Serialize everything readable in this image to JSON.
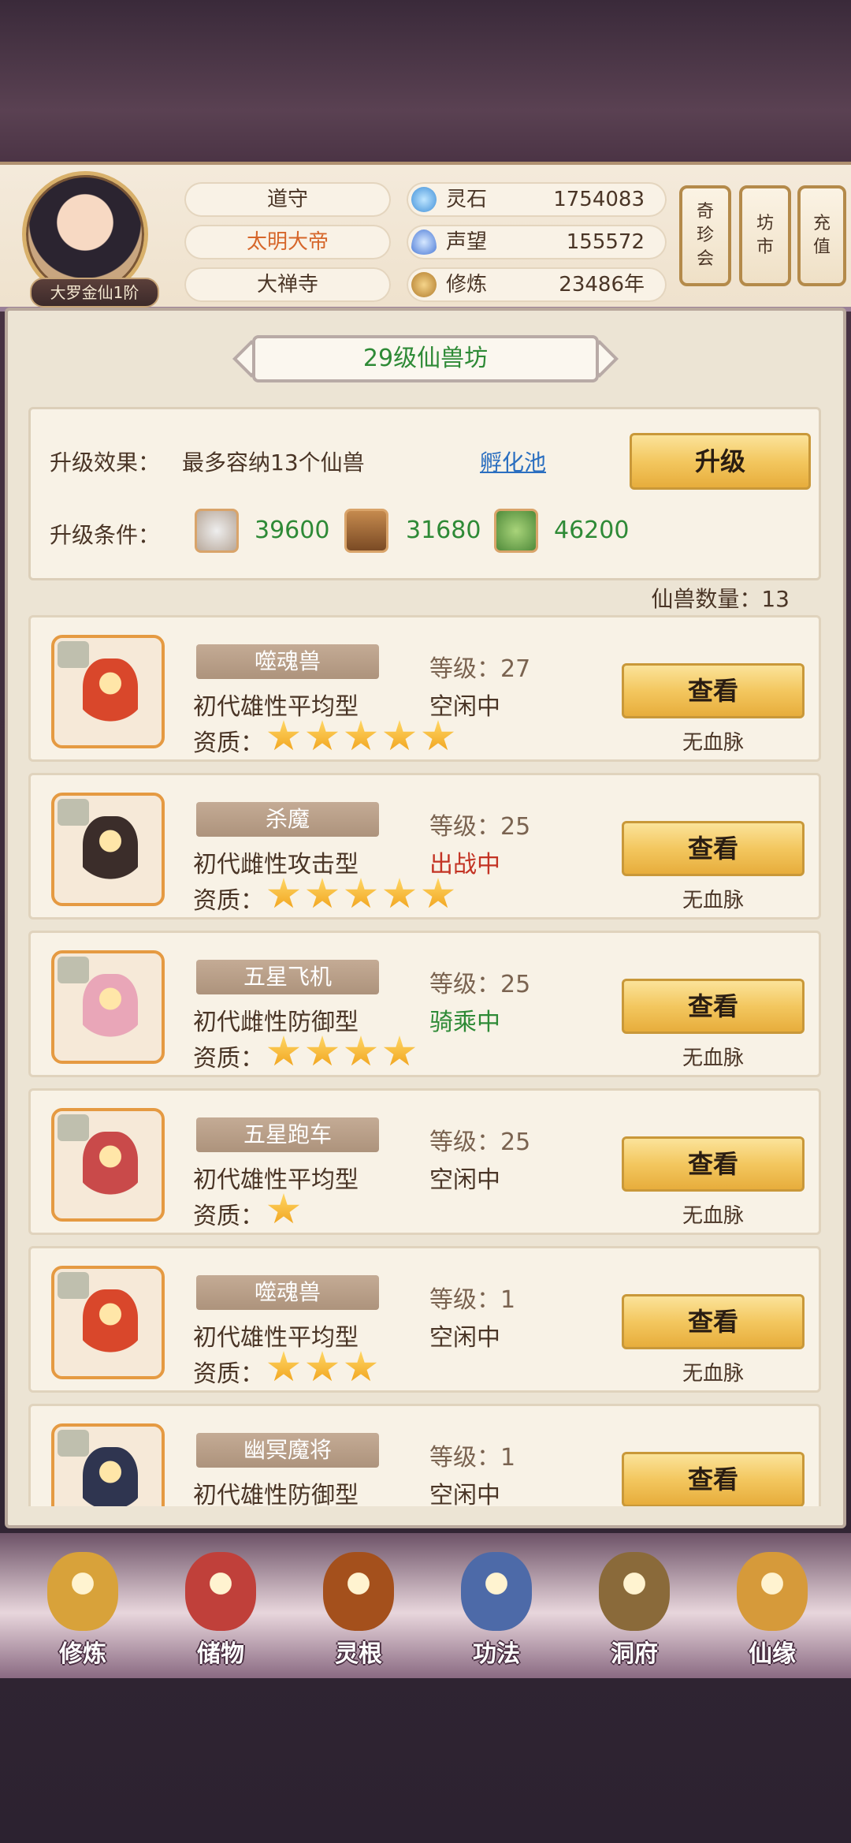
{
  "header": {
    "rank": "大罗金仙1阶",
    "info_pills": [
      "道守",
      "太明大帝",
      "大禅寺"
    ],
    "resources": [
      {
        "icon": "spirit-stone-icon",
        "label": "灵石",
        "value": "1754083"
      },
      {
        "icon": "reputation-icon",
        "label": "声望",
        "value": "155572"
      },
      {
        "icon": "cultivation-icon",
        "label": "修炼",
        "value": "23486年"
      }
    ],
    "shortcuts": [
      {
        "name": "qizhenhui",
        "chars": [
          "奇",
          "珍",
          "会"
        ]
      },
      {
        "name": "fangshi",
        "chars": [
          "坊",
          "市"
        ]
      },
      {
        "name": "chongzhi",
        "chars": [
          "充",
          "值"
        ]
      }
    ]
  },
  "panel": {
    "title": "29级仙兽坊",
    "upgrade_effect_label": "升级效果：",
    "upgrade_effect_text": "最多容纳13个仙兽",
    "hatch_link": "孵化池",
    "upgrade_button": "升级",
    "upgrade_cond_label": "升级条件：",
    "materials": [
      {
        "icon": "ore-icon",
        "value": "39600"
      },
      {
        "icon": "wood-icon",
        "value": "31680"
      },
      {
        "icon": "herb-icon",
        "value": "46200"
      }
    ],
    "count_label": "仙兽数量：13"
  },
  "quality_label": "资质：",
  "view_label": "查看",
  "beasts": [
    {
      "name": "噬魂兽",
      "type": "初代雄性平均型",
      "level": "等级：27",
      "status": "空闲中",
      "status_kind": "idle",
      "stars": 5,
      "blood": "无血脉",
      "color": "#d9472b"
    },
    {
      "name": "杀魔",
      "type": "初代雌性攻击型",
      "level": "等级：25",
      "status": "出战中",
      "status_kind": "battle",
      "stars": 5,
      "blood": "无血脉",
      "color": "#3b2d2a"
    },
    {
      "name": "五星飞机",
      "type": "初代雌性防御型",
      "level": "等级：25",
      "status": "骑乘中",
      "status_kind": "ride",
      "stars": 4,
      "blood": "无血脉",
      "color": "#e9a6b8"
    },
    {
      "name": "五星跑车",
      "type": "初代雄性平均型",
      "level": "等级：25",
      "status": "空闲中",
      "status_kind": "idle",
      "stars": 1,
      "blood": "无血脉",
      "color": "#c94a4a"
    },
    {
      "name": "噬魂兽",
      "type": "初代雄性平均型",
      "level": "等级：1",
      "status": "空闲中",
      "status_kind": "idle",
      "stars": 3,
      "blood": "无血脉",
      "color": "#d9472b"
    },
    {
      "name": "幽冥魔将",
      "type": "初代雄性防御型",
      "level": "等级：1",
      "status": "空闲中",
      "status_kind": "idle",
      "stars": 0,
      "blood": "",
      "color": "#2f3550"
    }
  ],
  "nav": [
    {
      "label": "修炼",
      "icon": "cultivate-icon",
      "color": "#d8a23a"
    },
    {
      "label": "储物",
      "icon": "storage-bag-icon",
      "color": "#c0403a"
    },
    {
      "label": "灵根",
      "icon": "spirit-root-icon",
      "color": "#a4501c"
    },
    {
      "label": "功法",
      "icon": "technique-book-icon",
      "color": "#4d6aa8"
    },
    {
      "label": "洞府",
      "icon": "cave-mansion-icon",
      "color": "#8a6a3a"
    },
    {
      "label": "仙缘",
      "icon": "fortune-gourd-icon",
      "color": "#d69a3a"
    }
  ]
}
